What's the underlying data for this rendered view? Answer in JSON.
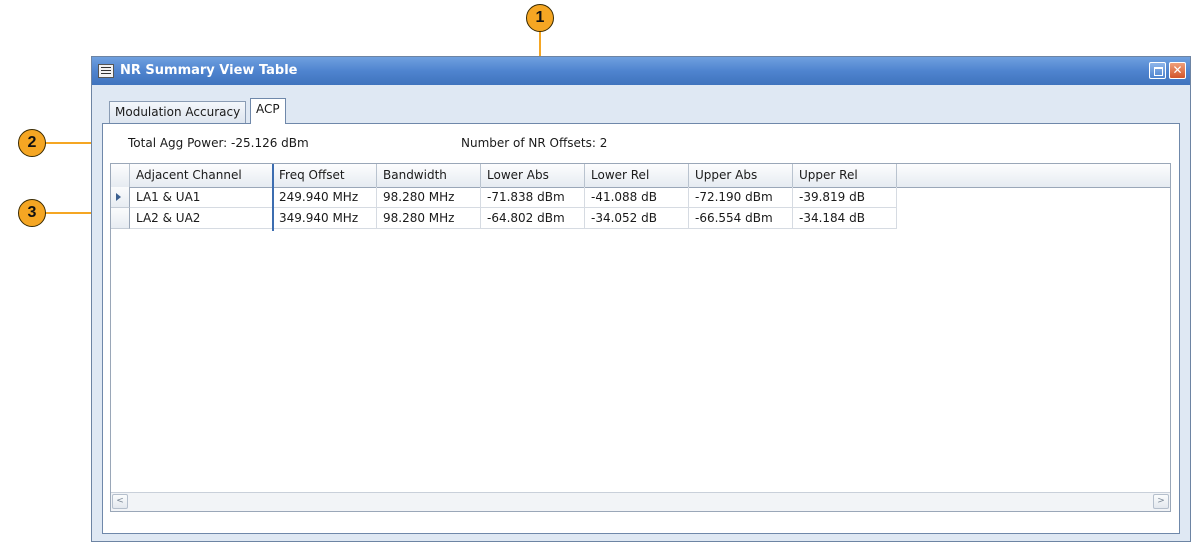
{
  "callouts": [
    "1",
    "2",
    "3"
  ],
  "window": {
    "title": "NR Summary View Table",
    "close_glyph": "✕"
  },
  "tabs": [
    {
      "label": "Modulation Accuracy",
      "selected": false
    },
    {
      "label": "ACP",
      "selected": true
    }
  ],
  "summary": {
    "total_agg_power": "Total Agg Power:  -25.126 dBm",
    "nr_offsets": "Number of NR Offsets:  2"
  },
  "table": {
    "columns": [
      "Adjacent Channel",
      "Freq Offset",
      "Bandwidth",
      "Lower Abs",
      "Lower Rel",
      "Upper Abs",
      "Upper Rel"
    ],
    "rows": [
      [
        "LA1 & UA1",
        "249.940 MHz",
        "98.280 MHz",
        "-71.838 dBm",
        "-41.088 dB",
        "-72.190 dBm",
        "-39.819 dB"
      ],
      [
        "LA2 & UA2",
        "349.940 MHz",
        "98.280 MHz",
        "-64.802 dBm",
        "-34.052 dB",
        "-66.554 dBm",
        "-34.184 dB"
      ]
    ],
    "current_row": 0
  },
  "scroll": {
    "left_glyph": "<",
    "right_glyph": ">"
  },
  "colors": {
    "callout": "#f5a623",
    "title_bar": "#4f84cf",
    "accent": "#3c6db0"
  }
}
